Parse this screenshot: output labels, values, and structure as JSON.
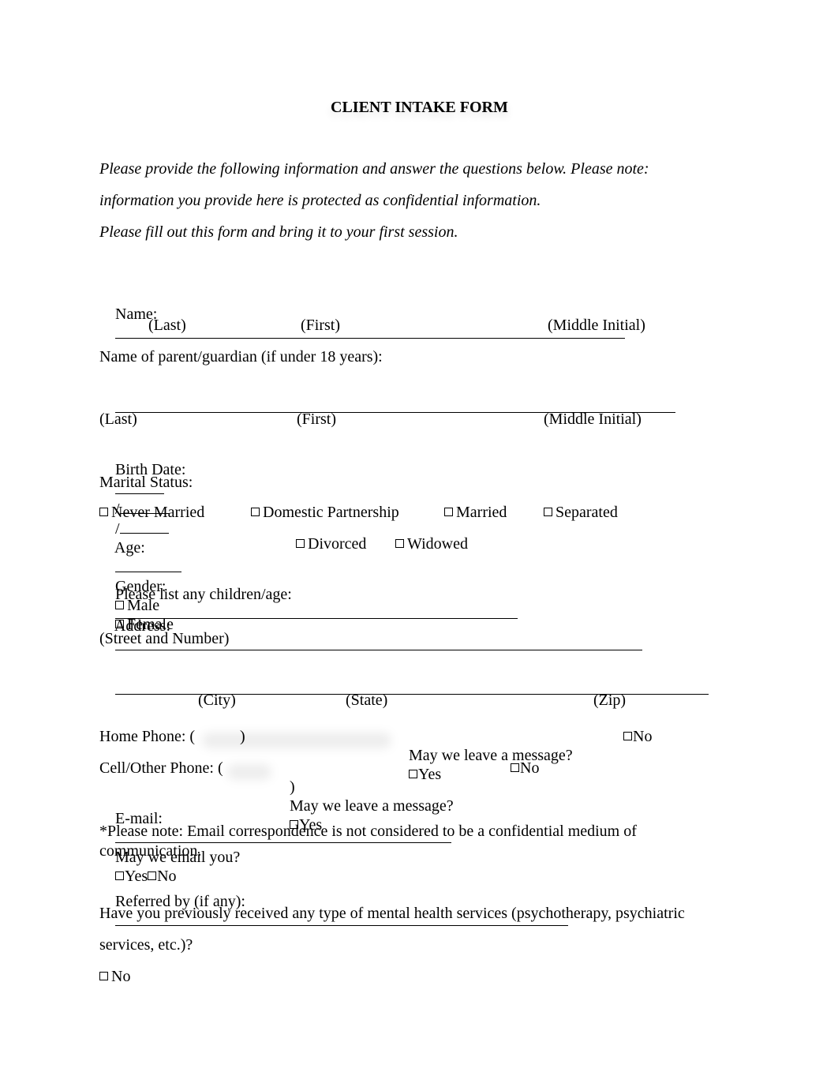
{
  "title": "CLIENT INTAKE FORM",
  "intro": {
    "line1": "Please provide the following information and answer the questions below. Please note:",
    "line2": "information you provide here is protected as confidential information.",
    "line3": "Please fill out this form and bring it to your first session."
  },
  "name": {
    "label": "Name:",
    "sub_last": "(Last)",
    "sub_first": "(First)",
    "sub_middle": "(Middle Initial)"
  },
  "guardian": {
    "label": "Name of parent/guardian (if under 18 years):",
    "sub_last": "(Last)",
    "sub_first": "(First)",
    "sub_middle": "(Middle Initial)"
  },
  "birth": {
    "label": "Birth Date:",
    "sep": "/",
    "age_label": "Age:",
    "gender_label": "Gender:",
    "gender_options": [
      "Male",
      "Female"
    ]
  },
  "marital": {
    "label": "Marital Status:",
    "options": [
      "Never Married",
      "Domestic Partnership",
      "Married",
      "Separated",
      "Divorced",
      "Widowed"
    ]
  },
  "children": {
    "label": "Please list any children/age:"
  },
  "address": {
    "label": "Address:",
    "sub_street": "(Street and Number)",
    "sub_city": "(City)",
    "sub_state": "(State)",
    "sub_zip": "(Zip)"
  },
  "home_phone": {
    "label": "Home Phone: (",
    "close": ")",
    "question": "May we leave a message?",
    "yes": "Yes",
    "no": "No"
  },
  "cell_phone": {
    "label": "Cell/Other Phone: (",
    "close": ")",
    "question": "May we leave a message?",
    "yes": "Yes",
    "no": "No"
  },
  "email": {
    "label": "E-mail:",
    "question": "May we email you?",
    "yes": "Yes",
    "no": "No"
  },
  "email_note": {
    "line1": "*Please note: Email correspondence is not considered to be a confidential medium of",
    "line2": "communication."
  },
  "referred": {
    "label": "Referred by (if any):"
  },
  "prior_services": {
    "line1": "Have you previously received any type of mental health services (psychotherapy, psychiatric",
    "line2": "services, etc.)?",
    "option_no": "No"
  }
}
